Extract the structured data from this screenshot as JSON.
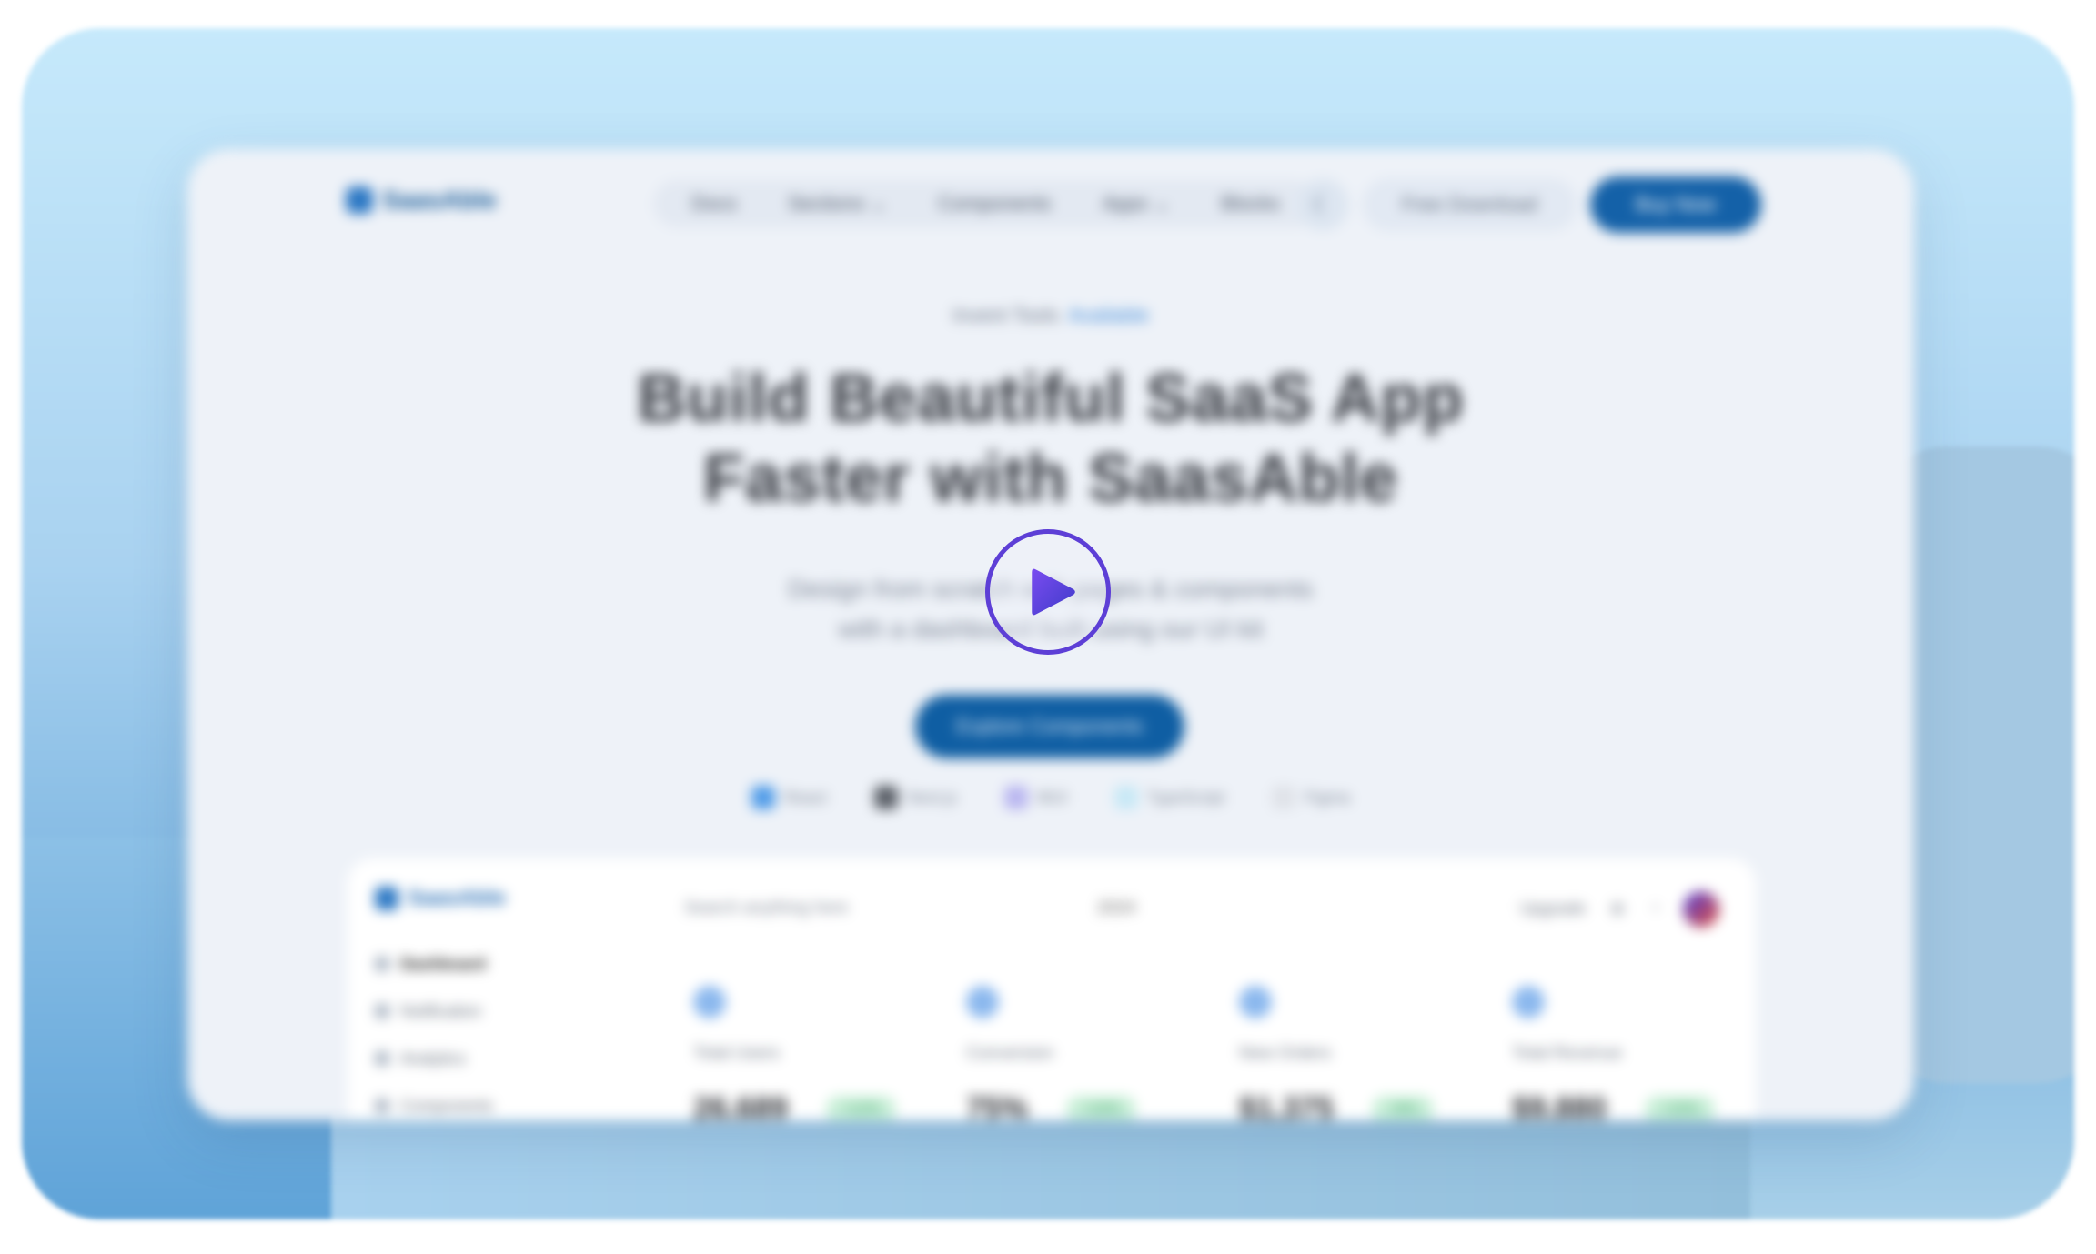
{
  "nav": {
    "brand": "SaasAble",
    "menu": [
      {
        "label": "Docs",
        "has_dropdown": false
      },
      {
        "label": "Sections",
        "has_dropdown": true
      },
      {
        "label": "Components",
        "has_dropdown": false
      },
      {
        "label": "Apps",
        "has_dropdown": true
      },
      {
        "label": "Blocks",
        "has_dropdown": false
      }
    ],
    "icon_button": "moon-icon",
    "secondary_cta": "Free Download",
    "primary_cta": "Buy Now"
  },
  "hero": {
    "eyebrow_text": "Invent Tools",
    "eyebrow_tag": "Available",
    "headline_line1": "Build Beautiful SaaS App",
    "headline_line2": "Faster with SaasAble",
    "subtext_line1": "Design from scratch with pages & components",
    "subtext_line2": "with a dashboard built using our UI kit",
    "cta": "Explore Components"
  },
  "tech_stack": [
    {
      "label": "React",
      "color": "#4f9be8"
    },
    {
      "label": "Next.js",
      "color": "#5a5f67"
    },
    {
      "label": "MUI",
      "color": "#b9b6f0"
    },
    {
      "label": "TypeScript",
      "color": "#c7e8f6"
    },
    {
      "label": "Figma",
      "color": "#dfe2e8"
    }
  ],
  "dashboard_preview": {
    "brand": "SaasAble",
    "sidebar": [
      {
        "label": "Dashboard",
        "active": true
      },
      {
        "label": "Notification",
        "active": false
      },
      {
        "label": "Analytics",
        "active": false
      },
      {
        "label": "Components",
        "active": false
      }
    ],
    "search_placeholder": "Search anything here",
    "year_selector": "2024",
    "upgrade": "Upgrade",
    "cards": [
      {
        "label": "Total Users",
        "value": "26,689",
        "delta": "+12%"
      },
      {
        "label": "Conversion",
        "value": "75%",
        "delta": "+10%"
      },
      {
        "label": "New Orders",
        "value": "$1,375",
        "delta": "+8%"
      },
      {
        "label": "Total Revenue",
        "value": "$9,880",
        "delta": "+15%"
      }
    ]
  },
  "video": {
    "play_icon": "play-icon",
    "accent": "#5d3fd6"
  },
  "colors": {
    "primary": "#1461a8",
    "background": "#eef2f8",
    "frame": "#b4dbf4"
  }
}
